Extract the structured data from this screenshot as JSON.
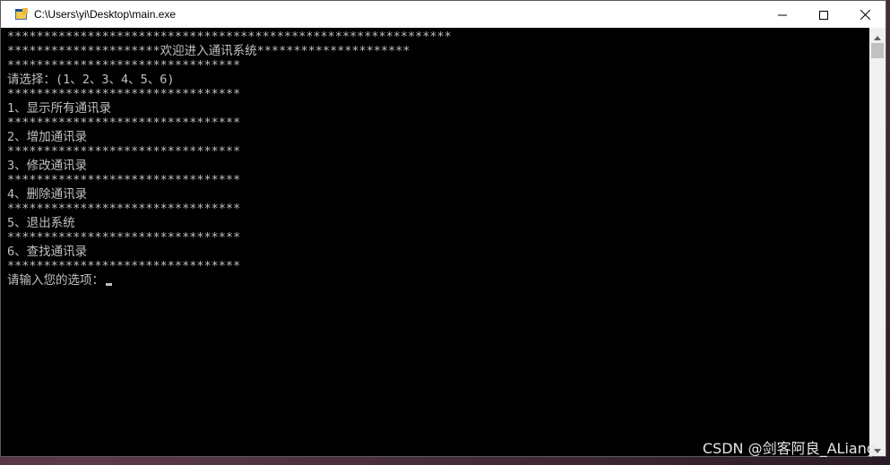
{
  "window": {
    "title": "C:\\Users\\yi\\Desktop\\main.exe"
  },
  "icons": {
    "app": "console-app-icon",
    "minimize": "minimize-icon",
    "maximize": "maximize-icon",
    "close": "close-icon",
    "scroll_up": "chevron-up-icon",
    "scroll_down": "chevron-down-icon"
  },
  "console": {
    "lines": [
      "*************************************************************",
      "*********************欢迎进入通讯系统*********************",
      "********************************",
      "请选择：(1、2、3、4、5、6)",
      "********************************",
      "1、显示所有通讯录",
      "********************************",
      "2、增加通讯录",
      "********************************",
      "3、修改通讯录",
      "********************************",
      "4、删除通讯录",
      "********************************",
      "5、退出系统",
      "********************************",
      "6、查找通讯录",
      "********************************",
      "请输入您的选项："
    ]
  },
  "watermark": "CSDN @剑客阿良_ALiang",
  "colors": {
    "console_bg": "#000000",
    "console_fg": "#c0c0c0",
    "titlebar_bg": "#ffffff",
    "scrollbar_bg": "#f0f0f0",
    "scroll_thumb": "#c1c1c1"
  }
}
